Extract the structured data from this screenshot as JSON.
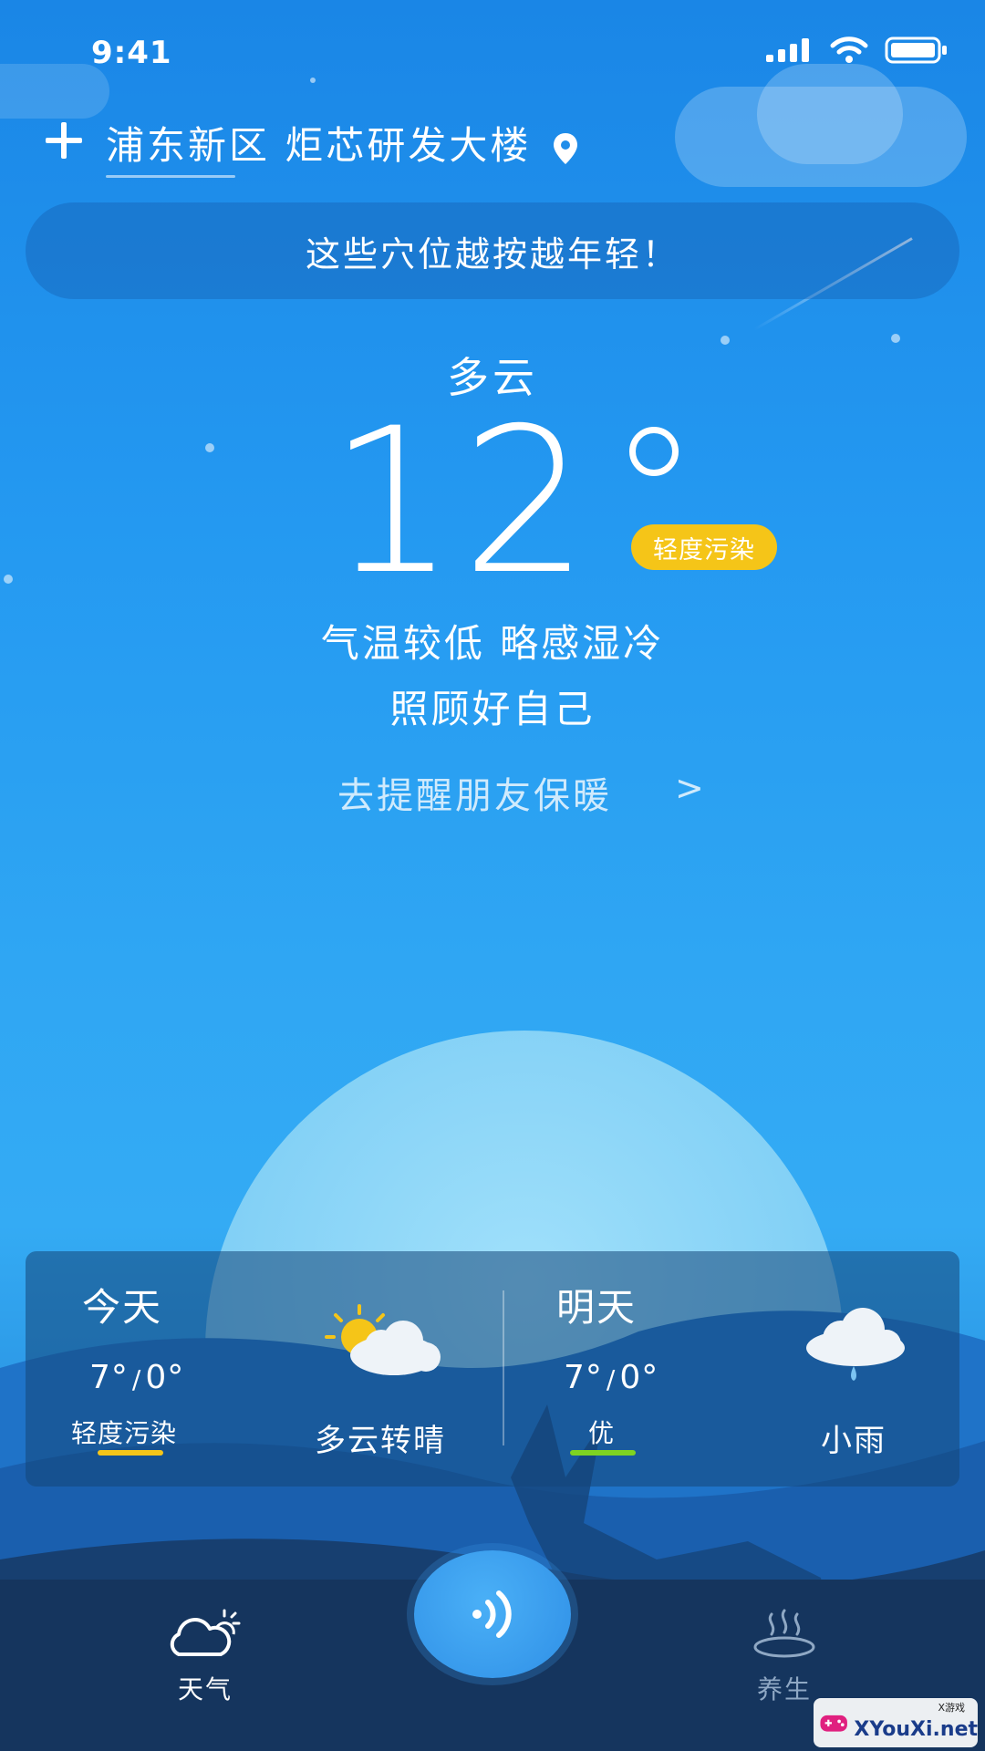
{
  "status_bar": {
    "time": "9:41",
    "icons": [
      "signal-icon",
      "wifi-icon",
      "battery-icon"
    ]
  },
  "header": {
    "add_icon": "plus-icon",
    "location": "浦东新区 炬芯研发大楼",
    "location_icon": "location-pin-icon"
  },
  "banner": {
    "text": "这些穴位越按越年轻！"
  },
  "current": {
    "condition": "多云",
    "temperature": "12",
    "aqi_label": "轻度污染",
    "aqi_color": "#f5c518",
    "desc_line1": "气温较低 略感湿冷",
    "desc_line2": "照顾好自己",
    "remind_link": "去提醒朋友保暖",
    "remind_chevron": ">"
  },
  "forecast": [
    {
      "day": "今天",
      "temp_high": "7°",
      "temp_sep": "/",
      "temp_low": "0°",
      "aqi": "轻度污染",
      "aqi_color": "#f5c518",
      "condition": "多云转晴",
      "icon": "partly-cloudy-sun-icon"
    },
    {
      "day": "明天",
      "temp_high": "7°",
      "temp_sep": "/",
      "temp_low": "0°",
      "aqi": "优",
      "aqi_color": "#7ed321",
      "condition": "小雨",
      "icon": "light-rain-icon"
    }
  ],
  "bottom_nav": {
    "items": [
      {
        "label": "天气",
        "icon": "weather-cloud-icon",
        "active": true
      },
      {
        "label": "养生",
        "icon": "hot-spring-icon",
        "active": false
      }
    ],
    "center_icon": "voice-broadcast-icon"
  },
  "watermark": {
    "text": "XYouXi.net",
    "small": "X游戏"
  },
  "colors": {
    "accent": "#2fa6f3",
    "nav_bg": "#15355e"
  }
}
